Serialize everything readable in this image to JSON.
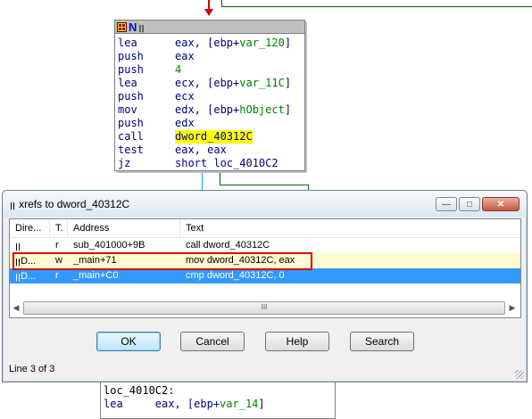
{
  "code_block": {
    "lines": [
      {
        "mn": "lea",
        "a": "eax, [ebp+",
        "v": "var_120",
        "b": "]"
      },
      {
        "mn": "push",
        "a": "eax",
        "v": "",
        "b": ""
      },
      {
        "mn": "push",
        "a": "",
        "v": "4",
        "b": ""
      },
      {
        "mn": "lea",
        "a": "ecx, [ebp+",
        "v": "var_11C",
        "b": "]"
      },
      {
        "mn": "push",
        "a": "ecx",
        "v": "",
        "b": ""
      },
      {
        "mn": "mov",
        "a": "edx, [ebp+",
        "v": "hObject",
        "b": "]"
      },
      {
        "mn": "push",
        "a": "edx",
        "v": "",
        "b": ""
      },
      {
        "mn": "call",
        "hl": "dword_40312C"
      },
      {
        "mn": "test",
        "a": "eax, eax",
        "v": "",
        "b": ""
      },
      {
        "mn": "jz",
        "a": "short loc_4010C2",
        "v": "",
        "b": ""
      }
    ]
  },
  "lower_block": {
    "label": "loc_4010C2:",
    "line2": "lea     eax, [ebp+var_14]"
  },
  "dialog": {
    "title": "xrefs to dword_40312C",
    "columns": [
      "Dire...",
      "T.",
      "Address",
      "Text"
    ],
    "rows": [
      {
        "dir": "",
        "type": "r",
        "address": "sub_401000+9B",
        "text": "call   dword_40312C"
      },
      {
        "dir": "D...",
        "type": "w",
        "address": "_main+71",
        "text": "mov    dword_40312C, eax"
      },
      {
        "dir": "D...",
        "type": "r",
        "address": "_main+C0",
        "text": "cmp    dword_40312C, 0"
      }
    ],
    "buttons": {
      "ok": "OK",
      "cancel": "Cancel",
      "help": "Help",
      "search": "Search"
    },
    "status": "Line 3 of 3",
    "scroll_thumb": "III"
  },
  "colors": {
    "highlight": "#ffff00",
    "selected_row": "#3399ff",
    "red_box": "#e00000",
    "graph_green": "#006400",
    "graph_red": "#d00000",
    "graph_cyan": "#00b0d0"
  }
}
